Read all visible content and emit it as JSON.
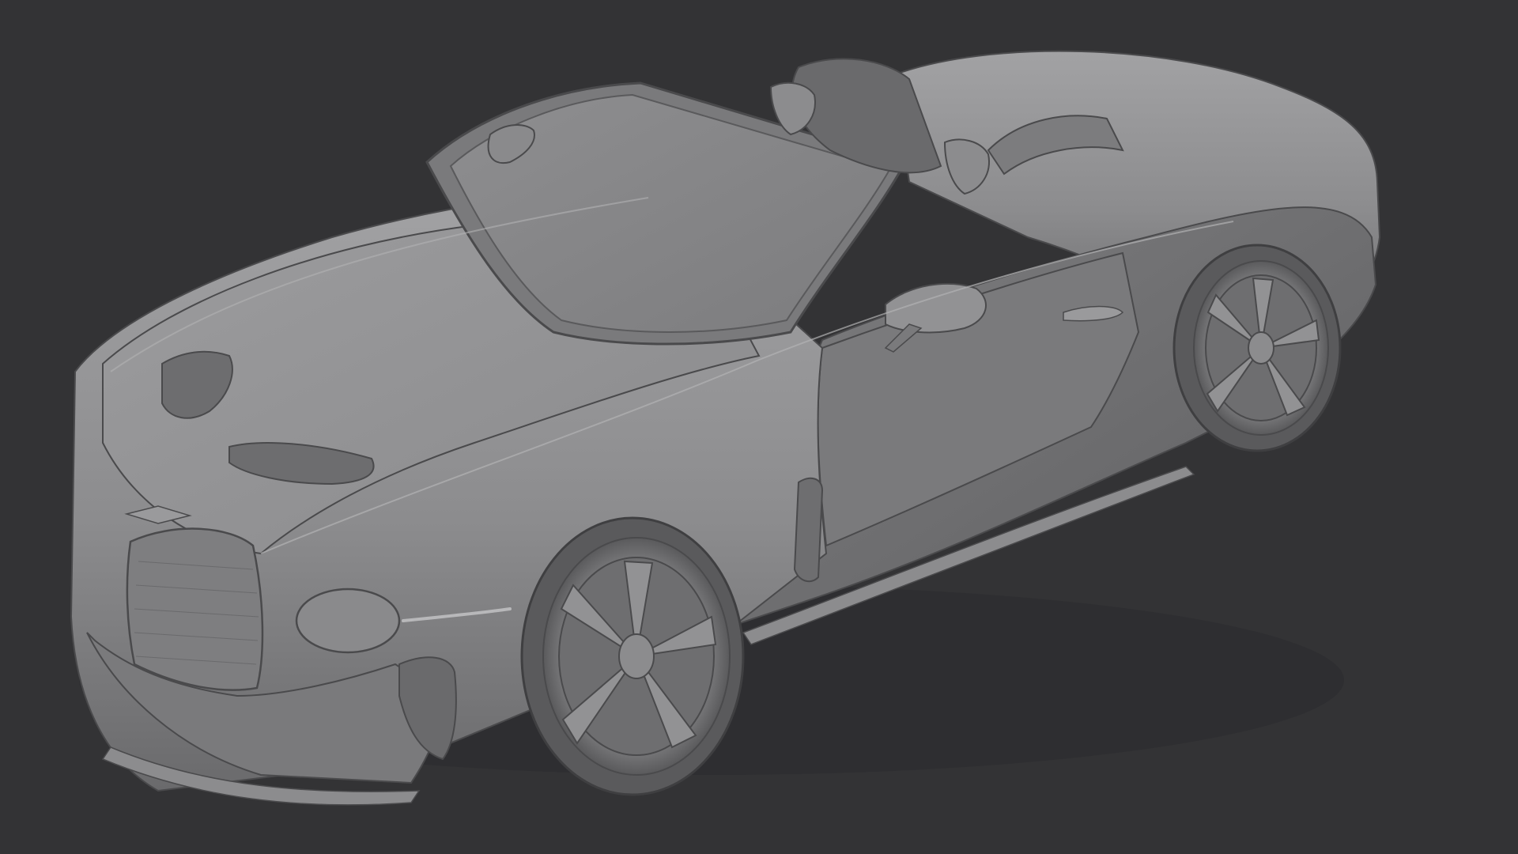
{
  "viewport": {
    "background": "#333335",
    "model_color": "#8f8f91",
    "shadow_color": "#5e5e60",
    "highlight_color": "#b2b2b4",
    "edge_color": "#4a4a4c"
  },
  "model": {
    "subject": "car-icon",
    "shading": "clay-render"
  }
}
